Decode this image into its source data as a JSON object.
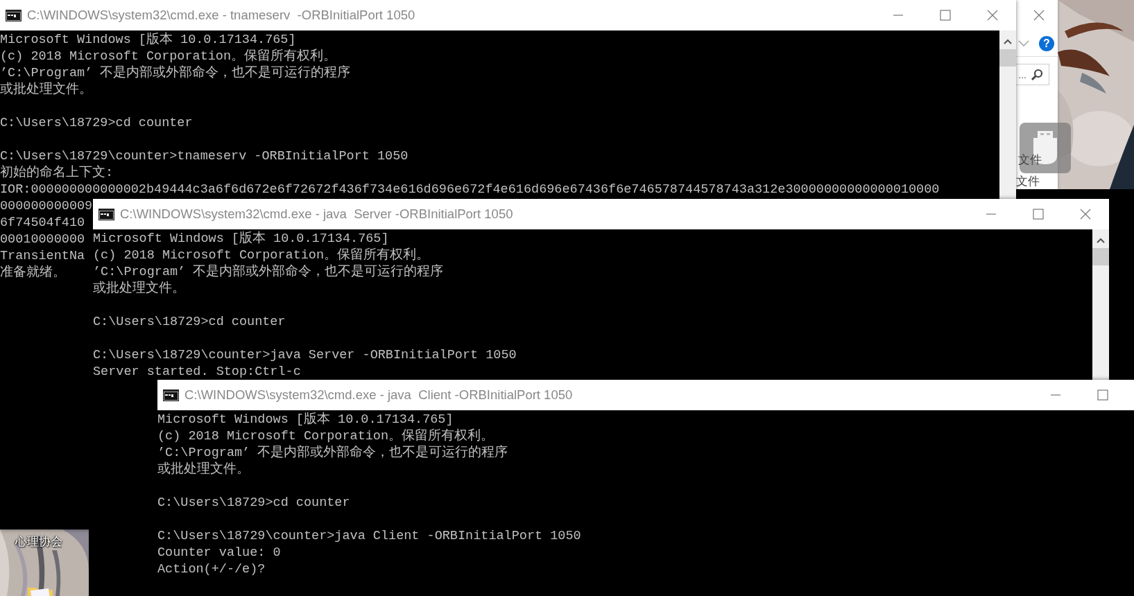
{
  "windows": [
    {
      "title": "C:\\WINDOWS\\system32\\cmd.exe - tnameserv  -ORBInitialPort 1050",
      "paragraphs": [
        [
          "Microsoft Windows [版本 10.0.17134.765]",
          "(c) 2018 Microsoft Corporation。保留所有权利。",
          "’C:\\Program’ 不是内部或外部命令，也不是可运行的程序",
          "或批处理文件。"
        ],
        [
          "C:\\Users\\18729>cd counter"
        ],
        [
          "C:\\Users\\18729\\counter>tnameserv -ORBInitialPort 1050",
          "初始的命名上下文:",
          "IOR:000000000000002b49444c3a6f6d672e6f72672f436f734e616d696e672f4e616d696e67436f6e746578744578743a312e30000000000000010000",
          "000000000009",
          "6f74504f410",
          "00010000000",
          "TransientNa",
          "准备就绪。"
        ]
      ]
    },
    {
      "title": "C:\\WINDOWS\\system32\\cmd.exe - java  Server -ORBInitialPort 1050",
      "paragraphs": [
        [
          "Microsoft Windows [版本 10.0.17134.765]",
          "(c) 2018 Microsoft Corporation。保留所有权利。",
          "’C:\\Program’ 不是内部或外部命令，也不是可运行的程序",
          "或批处理文件。"
        ],
        [
          "C:\\Users\\18729>cd counter"
        ],
        [
          "C:\\Users\\18729\\counter>java Server -ORBInitialPort 1050",
          "Server started. Stop:Ctrl-c"
        ]
      ]
    },
    {
      "title": "C:\\WINDOWS\\system32\\cmd.exe - java  Client -ORBInitialPort 1050",
      "paragraphs": [
        [
          "Microsoft Windows [版本 10.0.17134.765]",
          "(c) 2018 Microsoft Corporation。保留所有权利。",
          "’C:\\Program’ 不是内部或外部命令，也不是可运行的程序",
          "或批处理文件。"
        ],
        [
          "C:\\Users\\18729>cd counter"
        ],
        [
          "C:\\Users\\18729\\counter>java Client -ORBInitialPort 1050",
          "Counter value: 0",
          "Action(+/-/e)?"
        ]
      ]
    }
  ],
  "explorer": {
    "help": "?",
    "search_text": "...",
    "labels": [
      "文件",
      "文件"
    ]
  },
  "desktop_icon": {
    "label": "心理协会"
  }
}
